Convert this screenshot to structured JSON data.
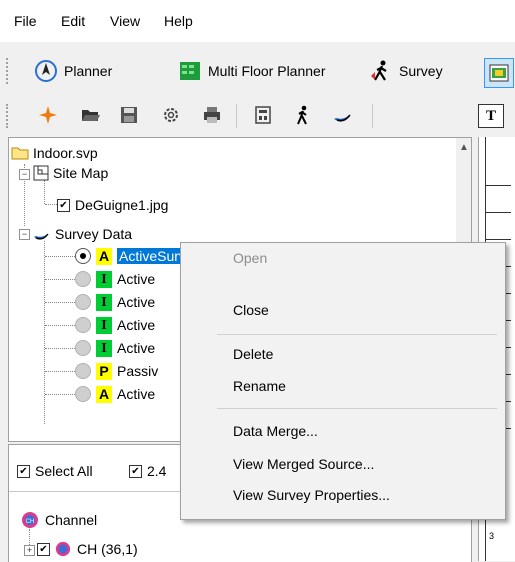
{
  "menubar": {
    "items": [
      "File",
      "Edit",
      "View",
      "Help"
    ]
  },
  "toolbar1": {
    "planner_label": "Planner",
    "multi_floor_label": "Multi Floor Planner",
    "survey_label": "Survey"
  },
  "tree": {
    "root": "Indoor.svp",
    "site_map": "Site Map",
    "image_file": "DeGuigne1.jpg",
    "survey_data": "Survey Data",
    "surveys": [
      {
        "badge": "A",
        "label": "ActiveSurvey2..."
      },
      {
        "badge": "I",
        "label": "Active"
      },
      {
        "badge": "I",
        "label": "Active"
      },
      {
        "badge": "I",
        "label": "Active"
      },
      {
        "badge": "I",
        "label": "Active"
      },
      {
        "badge": "P",
        "label": "Passiv"
      },
      {
        "badge": "A",
        "label": "Active"
      }
    ]
  },
  "bottom": {
    "select_all": "Select All",
    "band": "2.4",
    "channel_header": "Channel",
    "channel_item": "CH (36,1)"
  },
  "context_menu": {
    "open": "Open",
    "close": "Close",
    "delete": "Delete",
    "rename": "Rename",
    "data_merge": "Data Merge...",
    "view_merged": "View Merged Source...",
    "view_props": "View Survey Properties..."
  },
  "ruler": {
    "mark": "3"
  },
  "colors": {
    "selection": "#0078d7",
    "badge_active": "#ffff00",
    "badge_interference": "#00cc33"
  }
}
